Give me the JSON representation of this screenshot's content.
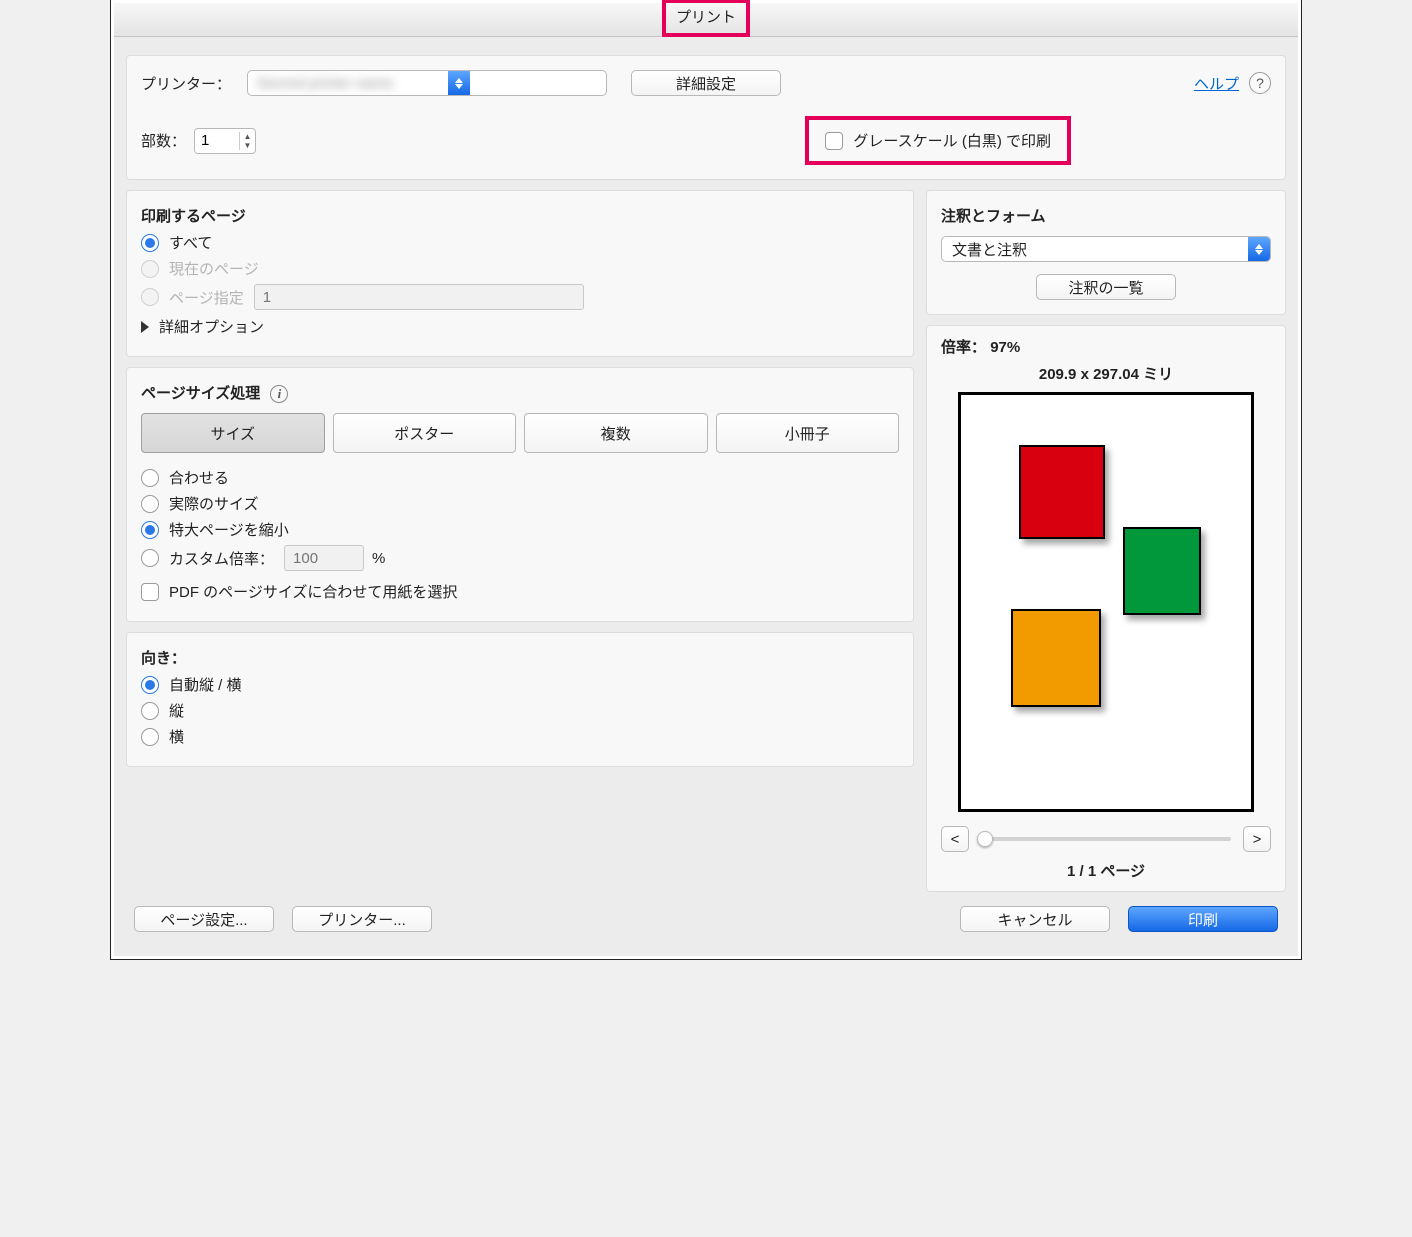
{
  "title": "プリント",
  "top": {
    "printer_label": "プリンター：",
    "printer_value": "blurred printer name",
    "advanced_btn": "詳細設定",
    "help_link": "ヘルプ",
    "copies_label": "部数：",
    "copies_value": "1",
    "grayscale_label": "グレースケール (白黒) で印刷"
  },
  "pages": {
    "heading": "印刷するページ",
    "all": "すべて",
    "current": "現在のページ",
    "range": "ページ指定",
    "range_placeholder": "1",
    "more": "詳細オプション"
  },
  "size_handling": {
    "heading": "ページサイズ処理",
    "tabs": {
      "size": "サイズ",
      "poster": "ポスター",
      "multi": "複数",
      "booklet": "小冊子"
    },
    "fit": "合わせる",
    "actual": "実際のサイズ",
    "shrink": "特大ページを縮小",
    "custom": "カスタム倍率：",
    "custom_value": "100",
    "percent": "%",
    "choose_by_pdf": "PDF のページサイズに合わせて用紙を選択"
  },
  "orientation": {
    "heading": "向き：",
    "auto": "自動縦 / 横",
    "portrait": "縦",
    "landscape": "横"
  },
  "comments": {
    "heading": "注釈とフォーム",
    "select_value": "文書と注釈",
    "summary_btn": "注釈の一覧"
  },
  "preview": {
    "scale_label": "倍率：",
    "scale_value": "97%",
    "dimensions": "209.9 x 297.04 ミリ",
    "prev": "<",
    "next": ">",
    "page_of": "1 / 1 ページ"
  },
  "footer": {
    "page_setup": "ページ設定...",
    "printer_btn": "プリンター...",
    "cancel": "キャンセル",
    "print": "印刷"
  }
}
